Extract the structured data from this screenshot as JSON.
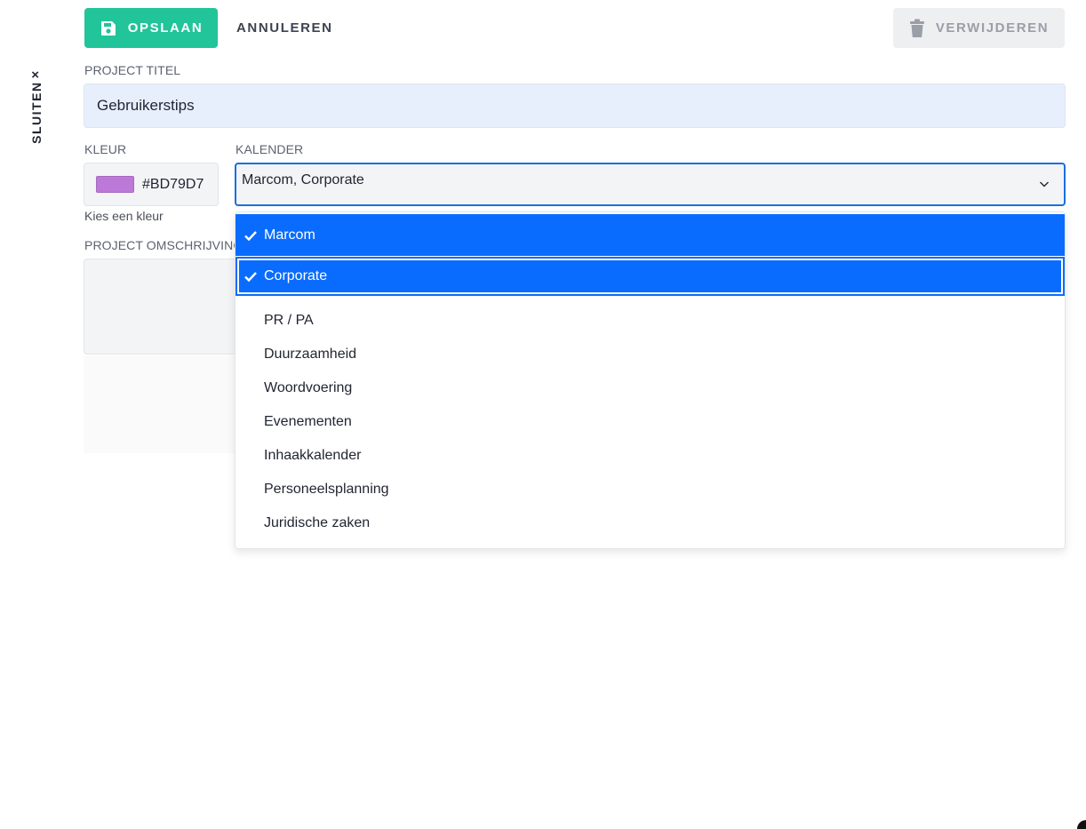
{
  "sidebar": {
    "close_label": "SLUITEN",
    "close_icon": "close-icon"
  },
  "toolbar": {
    "save_label": "OPSLAAN",
    "cancel_label": "ANNULEREN",
    "delete_label": "VERWIJDEREN",
    "save_color": "#22c49a"
  },
  "form": {
    "title_label": "PROJECT TITEL",
    "title_value": "Gebruikerstips",
    "color_label": "KLEUR",
    "color_value": "#BD79D7",
    "color_hint": "Kies een kleur",
    "calendar_label": "KALENDER",
    "calendar_value": "Marcom, Corporate",
    "description_label": "PROJECT OMSCHRIJVING"
  },
  "dropdown": {
    "options": [
      {
        "label": "Marcom",
        "selected": true
      },
      {
        "label": "Corporate",
        "selected": true
      },
      {
        "label": "PR / PA",
        "selected": false
      },
      {
        "label": "Duurzaamheid",
        "selected": false
      },
      {
        "label": "Woordvoering",
        "selected": false
      },
      {
        "label": "Evenementen",
        "selected": false
      },
      {
        "label": "Inhaakkalender",
        "selected": false
      },
      {
        "label": "Personeelsplanning",
        "selected": false
      },
      {
        "label": "Juridische zaken",
        "selected": false
      }
    ],
    "selected_color": "#0a6cff"
  }
}
